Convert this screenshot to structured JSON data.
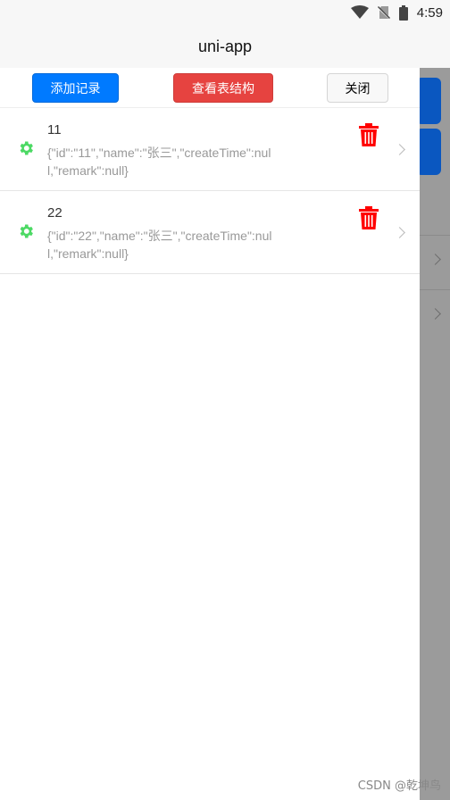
{
  "status_bar": {
    "time": "4:59"
  },
  "nav": {
    "title": "uni-app"
  },
  "toolbar": {
    "add_label": "添加记录",
    "schema_label": "查看表结构",
    "close_label": "关闭"
  },
  "records": [
    {
      "title": "11",
      "desc": "{\"id\":\"11\",\"name\":\"张三\",\"createTime\":null,\"remark\":null}"
    },
    {
      "title": "22",
      "desc": "{\"id\":\"22\",\"name\":\"张三\",\"createTime\":null,\"remark\":null}"
    }
  ],
  "watermark": "CSDN @乾坤鸟",
  "colors": {
    "primary": "#007aff",
    "danger": "#e64340",
    "gear": "#4cd964",
    "trash": "#ff0000"
  }
}
